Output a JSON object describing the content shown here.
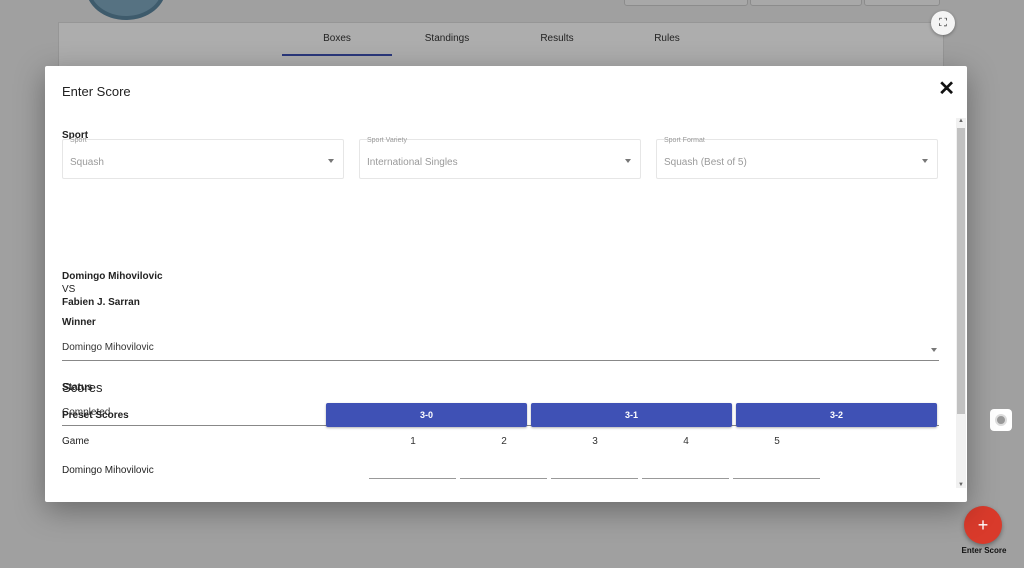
{
  "background": {
    "tabs": [
      {
        "label": "Boxes"
      },
      {
        "label": "Standings"
      },
      {
        "label": "Results"
      },
      {
        "label": "Rules"
      }
    ],
    "fab_label": "Enter Score",
    "fab_icon": "+"
  },
  "modal": {
    "title": "Enter Score",
    "close_icon": "✕",
    "sport_heading": "Sport",
    "sport": {
      "label": "Sport",
      "value": "Squash"
    },
    "variety": {
      "label": "Sport Variety",
      "value": "International Singles"
    },
    "format": {
      "label": "Sport Format",
      "value": "Squash (Best of 5)"
    },
    "player1": "Domingo Mihovilovic",
    "vs": "VS",
    "player2": "Fabien J. Sarran",
    "winner_label": "Winner",
    "winner_value": "Domingo Mihovilovic",
    "status_label": "Status",
    "status_value": "Completed",
    "scores_title": "Scores",
    "preset_label": "Preset Scores",
    "presets": [
      "3-0",
      "3-1",
      "3-2"
    ],
    "game_label": "Game",
    "games": [
      "1",
      "2",
      "3",
      "4",
      "5"
    ],
    "row_player": "Domingo Mihovilovic"
  },
  "colors": {
    "accent": "#3f51b5",
    "fab": "#d93a2b"
  }
}
